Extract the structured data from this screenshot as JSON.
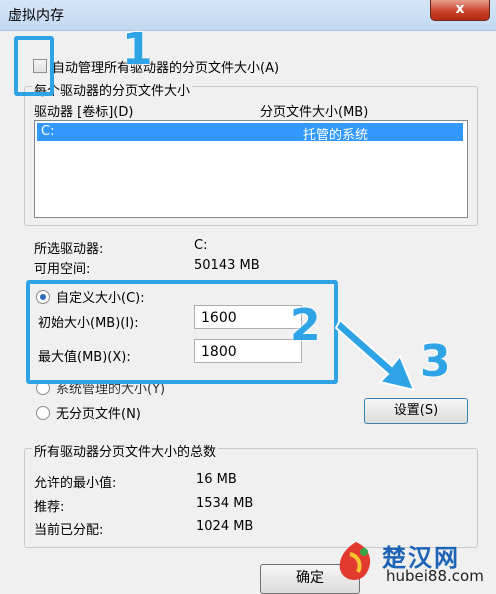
{
  "window": {
    "title": "虚拟内存",
    "close_label": "x"
  },
  "auto_manage": {
    "label": "自动管理所有驱动器的分页文件大小(A)",
    "checked": false
  },
  "per_drive_group": {
    "legend": "每个驱动器的分页文件大小",
    "columns": [
      "驱动器 [卷标](D)",
      "分页文件大小(MB)"
    ],
    "rows": [
      {
        "drive": "C:",
        "size": "托管的系统"
      }
    ]
  },
  "selected_drive": {
    "drive_label": "所选驱动器:",
    "drive_value": "C:",
    "space_label": "可用空间:",
    "space_value": "50143 MB"
  },
  "options": {
    "custom": {
      "label": "自定义大小(C):",
      "selected": true
    },
    "initial": {
      "label": "初始大小(MB)(I):",
      "value": "1600"
    },
    "maximum": {
      "label": "最大值(MB)(X):",
      "value": "1800"
    },
    "system": {
      "label": "系统管理的大小(Y)",
      "selected": false
    },
    "none": {
      "label": "无分页文件(N)",
      "selected": false
    },
    "set_button": "设置(S)"
  },
  "totals_group": {
    "legend": "所有驱动器分页文件大小的总数",
    "min_label": "允许的最小值:",
    "min_value": "16 MB",
    "recommended_label": "推荐:",
    "recommended_value": "1534 MB",
    "allocated_label": "当前已分配:",
    "allocated_value": "1024 MB"
  },
  "footer": {
    "ok_label": "确定"
  },
  "annotations": {
    "step1": "1",
    "step2": "2",
    "step3": "3",
    "accent_color": "#2ea3e6"
  },
  "watermark": {
    "brand": "楚汉网",
    "url": "hubei88.com"
  }
}
